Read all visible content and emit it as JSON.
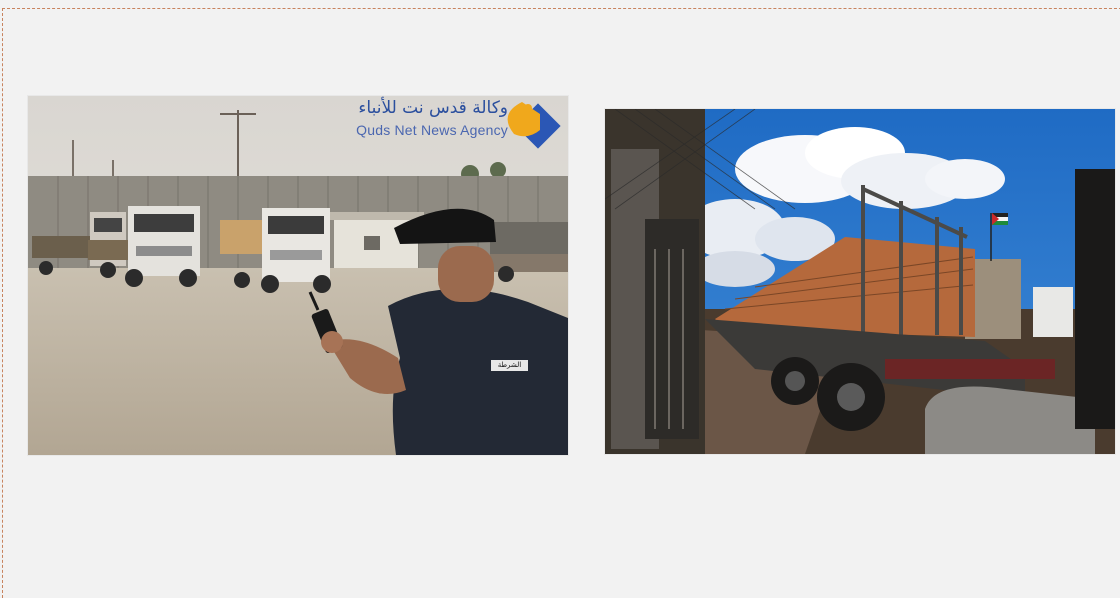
{
  "photos": [
    {
      "name": "checkpoint-photo",
      "watermark": {
        "arabic": "وكالة قدس نت للأنباء",
        "english": "Quds Net News Agency"
      },
      "badge": "الشرطة"
    },
    {
      "name": "cement-truck-photo"
    }
  ],
  "colors": {
    "frame_border": "#c8835e",
    "page_background": "#f2f2f2",
    "watermark_blue": "#2b4f9e",
    "logo_orange": "#f0a81c"
  },
  "icons": [
    "quds-news-logo-icon",
    "palestinian-flag-icon"
  ]
}
